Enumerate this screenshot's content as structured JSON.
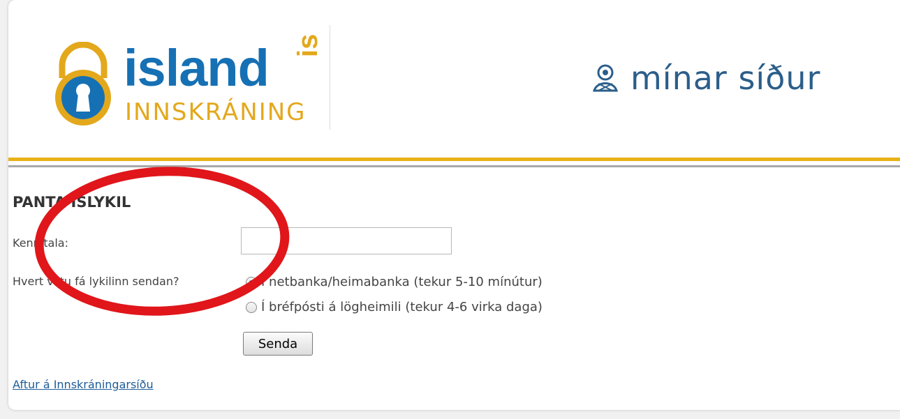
{
  "header": {
    "logo_main": "island",
    "logo_suffix": "is",
    "logo_sub": "INNSKRÁNING",
    "brand_text": "mínar síður",
    "brand_icon": "person-icon"
  },
  "form": {
    "title": "PANTA ÍSLYKIL",
    "kennitala_label": "Kennitala:",
    "kennitala_value": "",
    "delivery_question": "Hvert viltu fá lykilinn sendan?",
    "options": [
      {
        "label": "Í netbanka/heimabanka (tekur 5-10 mínútur)",
        "checked": true
      },
      {
        "label": "Í bréfpósti á lögheimili (tekur 4-6 virka daga)",
        "checked": false
      }
    ],
    "submit_label": "Senda"
  },
  "footer": {
    "back_link": "Aftur á Innskráningarsíðu"
  },
  "colors": {
    "logo_blue": "#1670b4",
    "logo_gold": "#e3a81c",
    "brand_blue": "#2b5e8a",
    "bar_gold": "#e8b217",
    "annotation_red": "#e0161b"
  }
}
